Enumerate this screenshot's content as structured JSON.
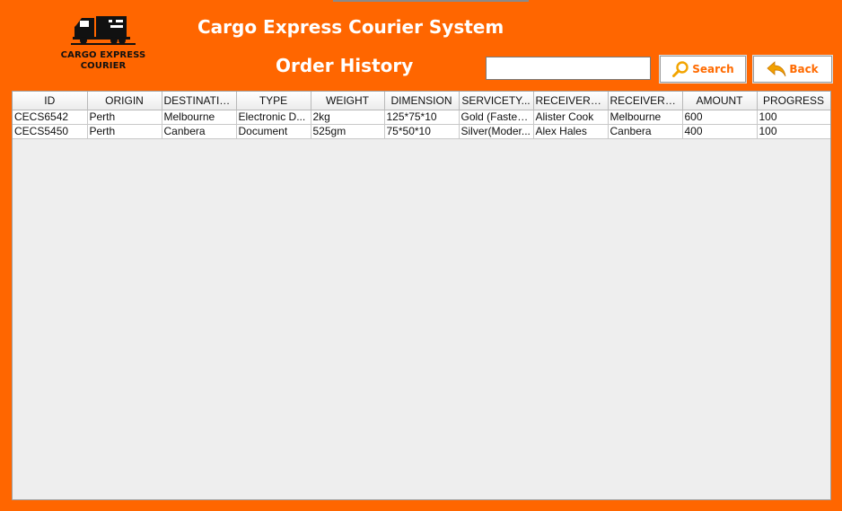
{
  "header": {
    "logo_line1": "CARGO EXPRESS",
    "logo_line2": "COURIER",
    "title": "Cargo Express Courier System",
    "subtitle": "Order History"
  },
  "search": {
    "value": "",
    "placeholder": ""
  },
  "buttons": {
    "search_label": "Search",
    "back_label": "Back"
  },
  "colors": {
    "frame": "#ff6600",
    "button_text": "#ff6a00"
  },
  "icons": {
    "search": "magnifier-icon",
    "back": "back-arrow-icon",
    "logo": "truck-icon"
  },
  "table": {
    "columns": [
      "ID",
      "ORIGIN",
      "DESTINATION",
      "TYPE",
      "WEIGHT",
      "DIMENSION",
      "SERVICETY...",
      "RECEIVERN...",
      "RECEIVERA...",
      "AMOUNT",
      "PROGRESS"
    ],
    "rows": [
      [
        "CECS6542",
        "Perth",
        "Melbourne",
        "Electronic D...",
        "2kg",
        "125*75*10",
        "Gold (Fastes...",
        "Alister Cook",
        "Melbourne",
        "600",
        "100"
      ],
      [
        "CECS5450",
        "Perth",
        "Canbera",
        "Document",
        "525gm",
        "75*50*10",
        "Silver(Moder...",
        "Alex Hales",
        "Canbera",
        "400",
        "100"
      ]
    ]
  }
}
